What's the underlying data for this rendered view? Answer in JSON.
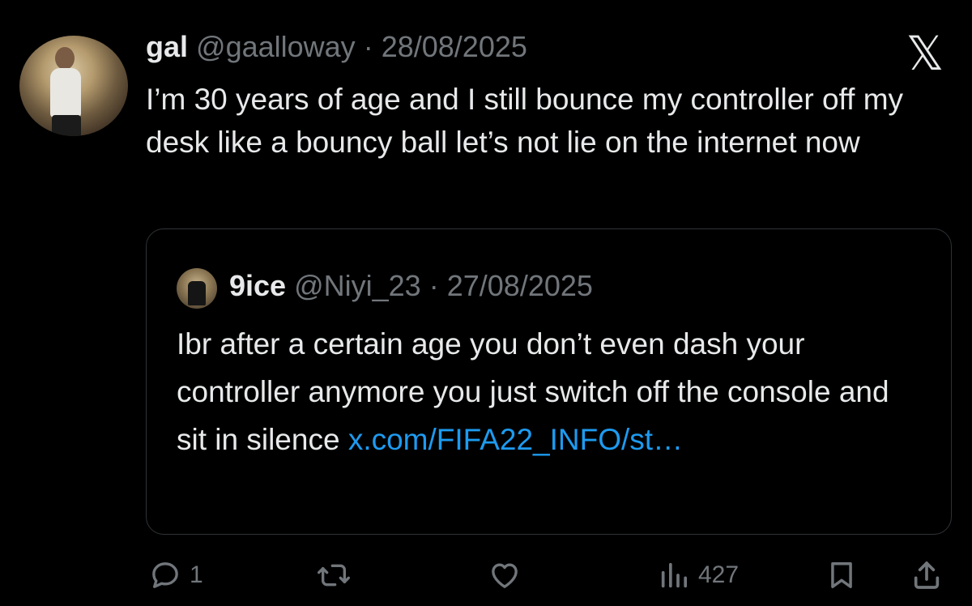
{
  "tweet": {
    "display_name": "gal",
    "handle": "@gaalloway",
    "separator": "·",
    "date": "28/08/2025",
    "text": "I’m 30 years of age and I still bounce my controller off my desk like a bouncy ball let’s not lie on the internet now"
  },
  "quote": {
    "display_name": "9ice",
    "handle": "@Niyi_23",
    "separator": "·",
    "date": "27/08/2025",
    "text": "Ibr after a certain age you don’t even dash your controller anymore you just switch off the console and sit in silence ",
    "link_text": "x.com/FIFA22_INFO/st…"
  },
  "actions": {
    "replies": "1",
    "reposts": "",
    "likes": "",
    "views": "427"
  },
  "icons": {
    "platform": "x-logo-icon",
    "reply": "reply-icon",
    "repost": "repost-icon",
    "like": "heart-icon",
    "views": "views-bar-chart-icon",
    "bookmark": "bookmark-icon",
    "share": "share-icon"
  },
  "colors": {
    "background": "#000000",
    "text": "#e7e9ea",
    "secondary": "#71767b",
    "link": "#1d9bf0",
    "border": "#2f3336"
  }
}
